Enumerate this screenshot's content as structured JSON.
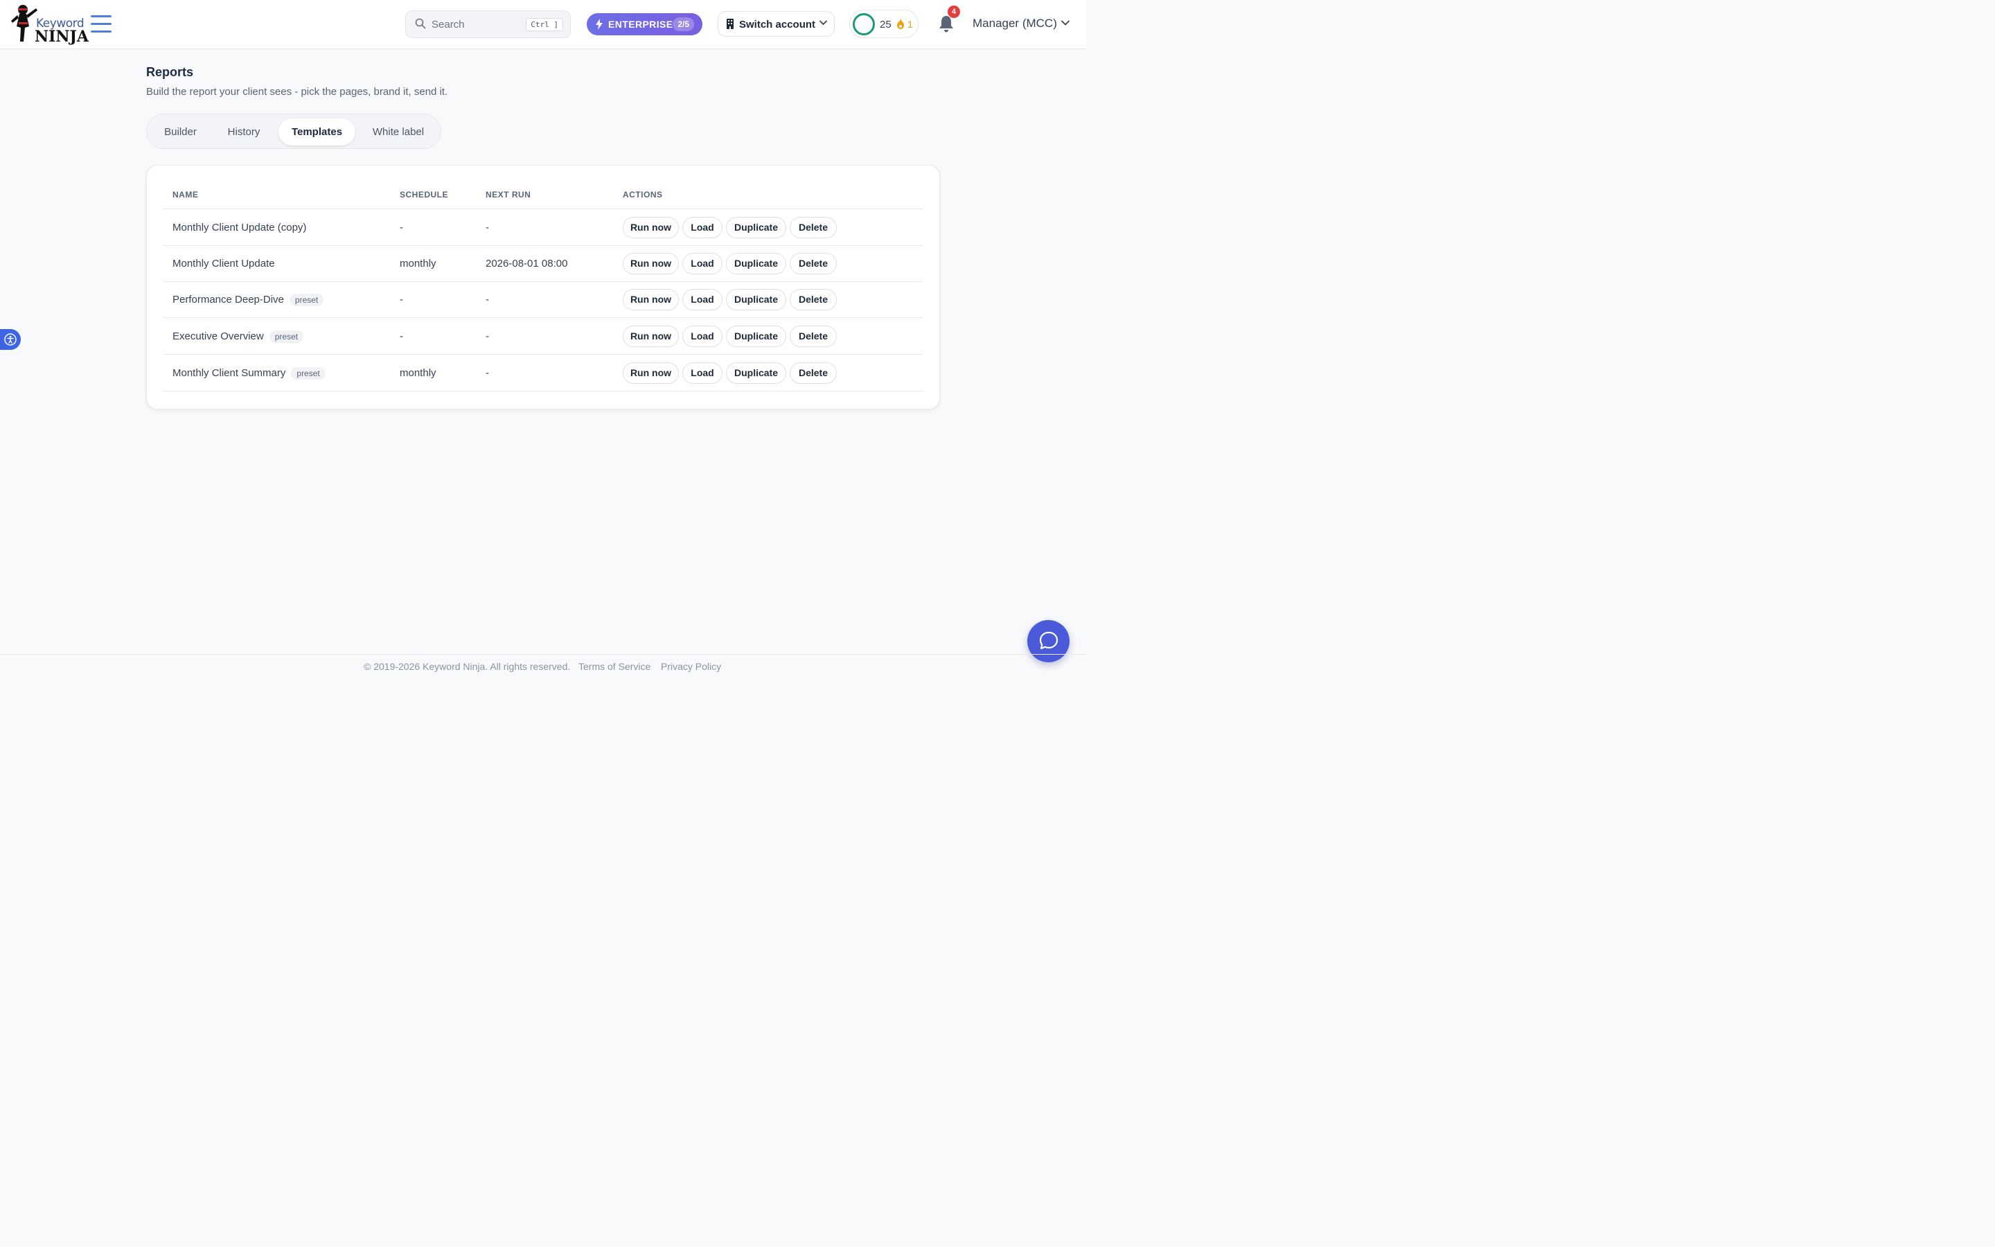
{
  "header": {
    "brand_top": "Keyword",
    "brand_bottom": "NINJA",
    "search_placeholder": "Search",
    "search_shortcut": "Ctrl ]",
    "plan_label": "ENTERPRISE",
    "plan_count": "2/5",
    "switch_account_label": "Switch account",
    "score_value": "25",
    "streak_value": "1",
    "notification_count": "4",
    "account_label": "Manager (MCC)"
  },
  "page": {
    "title": "Reports",
    "subtitle": "Build the report your client sees - pick the pages, brand it, send it."
  },
  "tabs": [
    {
      "label": "Builder",
      "active": false
    },
    {
      "label": "History",
      "active": false
    },
    {
      "label": "Templates",
      "active": true
    },
    {
      "label": "White label",
      "active": false
    }
  ],
  "table": {
    "columns": [
      "NAME",
      "SCHEDULE",
      "NEXT RUN",
      "ACTIONS"
    ],
    "actions": [
      "Run now",
      "Load",
      "Duplicate",
      "Delete"
    ],
    "rows": [
      {
        "name": "Monthly Client Update (copy)",
        "tag": "",
        "schedule": "-",
        "next_run": "-"
      },
      {
        "name": "Monthly Client Update",
        "tag": "",
        "schedule": "monthly",
        "next_run": "2026-08-01 08:00"
      },
      {
        "name": "Performance Deep-Dive",
        "tag": "preset",
        "schedule": "-",
        "next_run": "-"
      },
      {
        "name": "Executive Overview",
        "tag": "preset",
        "schedule": "-",
        "next_run": "-"
      },
      {
        "name": "Monthly Client Summary",
        "tag": "preset",
        "schedule": "monthly",
        "next_run": "-"
      }
    ]
  },
  "footer": {
    "copyright": "© 2019-2026 Keyword Ninja. All rights reserved.",
    "terms": "Terms of Service",
    "privacy": "Privacy Policy"
  },
  "colors": {
    "accent": "#4f7de3",
    "plan_gradient_start": "#6d6ee8",
    "score_ring": "#1a9b74",
    "badge": "#e53e3e",
    "chat": "#4a5ad8"
  },
  "icons": [
    "ninja-logo",
    "hamburger-menu-icon",
    "search-icon",
    "bolt-icon",
    "building-icon",
    "chevron-down-icon",
    "fire-icon",
    "bell-icon",
    "accessibility-icon",
    "chat-icon"
  ]
}
